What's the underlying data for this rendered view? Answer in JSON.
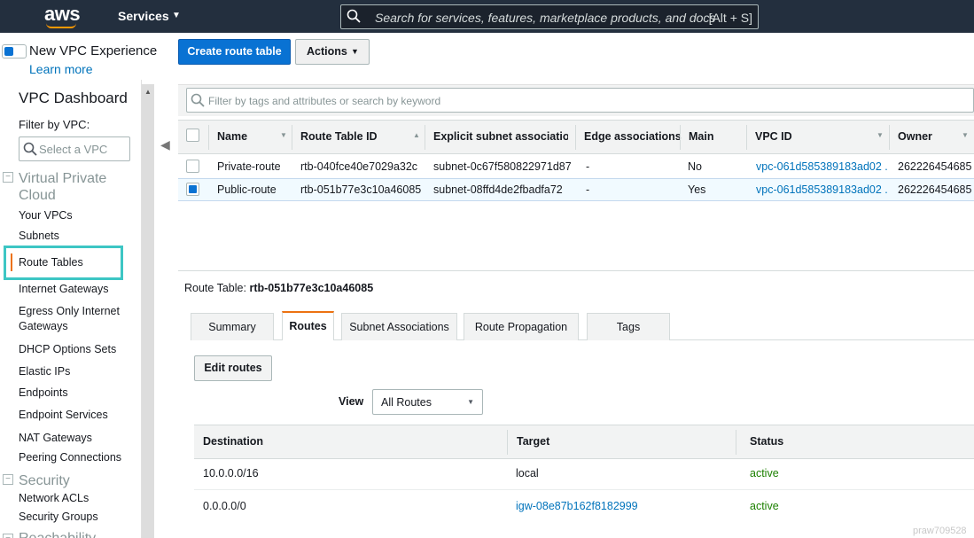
{
  "topnav": {
    "logo": "aws",
    "services_label": "Services",
    "search_placeholder": "Search for services, features, marketplace products, and docs",
    "search_shortcut": "[Alt + S]"
  },
  "experience": {
    "label": "New VPC Experience",
    "learn_more": "Learn more"
  },
  "toolbar": {
    "create_label": "Create route table",
    "actions_label": "Actions"
  },
  "sidebar": {
    "header": "VPC Dashboard",
    "filter_label": "Filter by VPC:",
    "vpc_select_placeholder": "Select a VPC",
    "section_vpc": "Virtual Private Cloud",
    "items": [
      "Your VPCs",
      "Subnets",
      "Route Tables",
      "Internet Gateways",
      "Egress Only Internet Gateways",
      "DHCP Options Sets",
      "Elastic IPs",
      "Endpoints",
      "Endpoint Services",
      "NAT Gateways",
      "Peering Connections"
    ],
    "section_security": "Security",
    "security_items": [
      "Network ACLs",
      "Security Groups"
    ],
    "section_partial": "Reachability"
  },
  "filter": {
    "placeholder": "Filter by tags and attributes or search by keyword"
  },
  "table": {
    "columns": [
      "Name",
      "Route Table ID",
      "Explicit subnet association",
      "Edge associations",
      "Main",
      "VPC ID",
      "Owner"
    ],
    "rows": [
      {
        "name": "Private-route",
        "route_table_id": "rtb-040fce40e7029a32c",
        "subnet": "subnet-0c67f580822971d87",
        "edge": "-",
        "main": "No",
        "vpc_id": "vpc-061d585389183ad02 ...",
        "owner": "262226454685",
        "selected": false
      },
      {
        "name": "Public-route",
        "route_table_id": "rtb-051b77e3c10a46085",
        "subnet": "subnet-08ffd4de2fbadfa72",
        "edge": "-",
        "main": "Yes",
        "vpc_id": "vpc-061d585389183ad02 ...",
        "owner": "262226454685",
        "selected": true
      }
    ]
  },
  "details": {
    "label": "Route Table:",
    "id": "rtb-051b77e3c10a46085",
    "tabs": [
      "Summary",
      "Routes",
      "Subnet Associations",
      "Route Propagation",
      "Tags"
    ],
    "active_tab": "Routes",
    "edit_routes_label": "Edit routes",
    "view_label": "View",
    "view_value": "All Routes",
    "routes_columns": [
      "Destination",
      "Target",
      "Status"
    ],
    "routes": [
      {
        "destination": "10.0.0.0/16",
        "target": "local",
        "status": "active"
      },
      {
        "destination": "0.0.0.0/0",
        "target": "igw-08e87b162f8182999",
        "status": "active"
      }
    ]
  },
  "watermark": "praw709528",
  "colors": {
    "nav_bg": "#232f3e",
    "primary": "#0972d3",
    "link": "#0073bb",
    "active_status": "#1d8102",
    "tab_accent": "#ec7211",
    "highlight_box": "#3dc6c4"
  }
}
